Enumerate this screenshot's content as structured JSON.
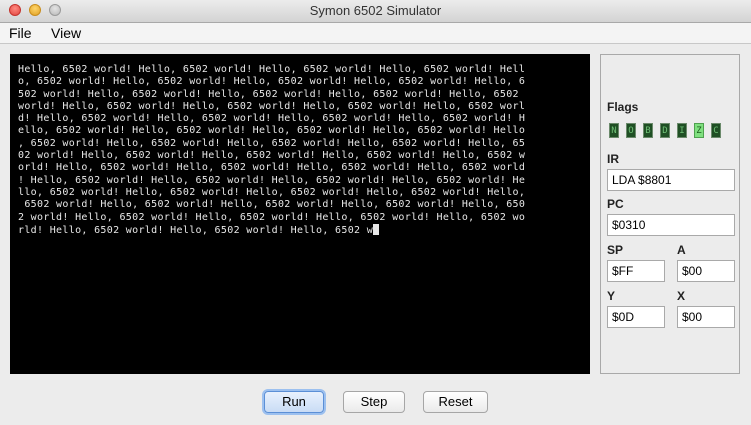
{
  "window": {
    "title": "Symon 6502 Simulator"
  },
  "menu": {
    "file": "File",
    "view": "View"
  },
  "terminal": {
    "lines": [
      "Hello, 6502 world! Hello, 6502 world! Hello, 6502 world! Hello, 6502 world! Hell",
      "o, 6502 world! Hello, 6502 world! Hello, 6502 world! Hello, 6502 world! Hello, 6",
      "502 world! Hello, 6502 world! Hello, 6502 world! Hello, 6502 world! Hello, 6502",
      "world! Hello, 6502 world! Hello, 6502 world! Hello, 6502 world! Hello, 6502 worl",
      "d! Hello, 6502 world! Hello, 6502 world! Hello, 6502 world! Hello, 6502 world! H",
      "ello, 6502 world! Hello, 6502 world! Hello, 6502 world! Hello, 6502 world! Hello",
      ", 6502 world! Hello, 6502 world! Hello, 6502 world! Hello, 6502 world! Hello, 65",
      "02 world! Hello, 6502 world! Hello, 6502 world! Hello, 6502 world! Hello, 6502 w",
      "orld! Hello, 6502 world! Hello, 6502 world! Hello, 6502 world! Hello, 6502 world",
      "! Hello, 6502 world! Hello, 6502 world! Hello, 6502 world! Hello, 6502 world! He",
      "llo, 6502 world! Hello, 6502 world! Hello, 6502 world! Hello, 6502 world! Hello,",
      " 6502 world! Hello, 6502 world! Hello, 6502 world! Hello, 6502 world! Hello, 650",
      "2 world! Hello, 6502 world! Hello, 6502 world! Hello, 6502 world! Hello, 6502 wo",
      "rld! Hello, 6502 world! Hello, 6502 world! Hello, 6502 w"
    ]
  },
  "registers": {
    "flags_label": "Flags",
    "flags": [
      {
        "name": "N",
        "on": false
      },
      {
        "name": "O",
        "on": false
      },
      {
        "name": "B",
        "on": false
      },
      {
        "name": "D",
        "on": false
      },
      {
        "name": "I",
        "on": false
      },
      {
        "name": "Z",
        "on": true
      },
      {
        "name": "C",
        "on": false
      }
    ],
    "ir_label": "IR",
    "ir_value": "LDA $8801",
    "pc_label": "PC",
    "pc_value": "$0310",
    "sp_label": "SP",
    "sp_value": "$FF",
    "a_label": "A",
    "a_value": "$00",
    "y_label": "Y",
    "y_value": "$0D",
    "x_label": "X",
    "x_value": "$00"
  },
  "buttons": {
    "run": "Run",
    "step": "Step",
    "reset": "Reset"
  }
}
